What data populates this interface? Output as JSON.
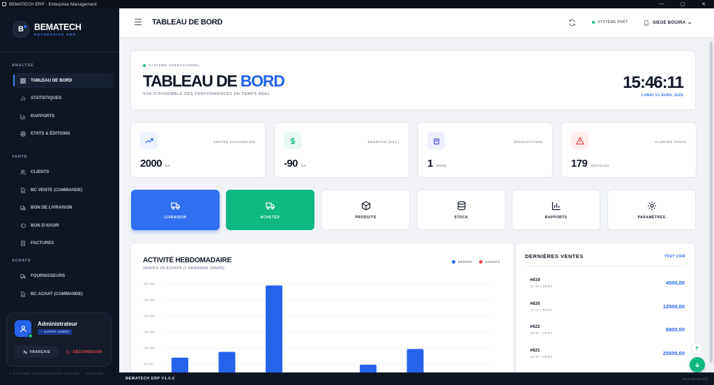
{
  "window": {
    "title": "BEMATECH ERP - Enterprise Management",
    "controls": {
      "minimize": "—",
      "maximize": "▢",
      "close": "✕"
    }
  },
  "brand": {
    "logo": "B",
    "name": "BEMATECH",
    "subtitle": "ENTERPRISE ERP"
  },
  "sidebar": {
    "sections": [
      {
        "label": "ANALYSE",
        "items": [
          {
            "label": "TABLEAU DE BORD",
            "icon": "dashboard-icon",
            "active": true
          },
          {
            "label": "STATISTIQUES",
            "icon": "stats-icon"
          },
          {
            "label": "RAPPORTS",
            "icon": "bar-chart-icon"
          },
          {
            "label": "ETATS & ÉDITIONS",
            "icon": "printer-icon"
          }
        ]
      },
      {
        "label": "VENTE",
        "items": [
          {
            "label": "CLIENTS",
            "icon": "users-icon"
          },
          {
            "label": "BC VENTE (COMMANDE)",
            "icon": "document-icon"
          },
          {
            "label": "BON DE LIVRAISON",
            "icon": "truck-icon"
          },
          {
            "label": "BON D'AVOIR",
            "icon": "undo-icon"
          },
          {
            "label": "FACTURES",
            "icon": "invoice-icon"
          }
        ]
      },
      {
        "label": "ACHATS",
        "items": [
          {
            "label": "FOURNISSEURS",
            "icon": "truck-icon"
          },
          {
            "label": "BC ACHAT (COMMANDE)",
            "icon": "document-icon"
          }
        ]
      }
    ]
  },
  "user": {
    "name": "Administrateur",
    "role": "⚡ SUPER ADMIN",
    "lang_button": "FRANÇAIS",
    "logout_button": "DÉCONNEXION"
  },
  "sidebar_footer": {
    "left": "• SYSTEM INTELLIGENCE ACTIVE",
    "right": "SECURE"
  },
  "topbar": {
    "title": "TABLEAU DE BORD",
    "status": "SYSTÈME PRÊT",
    "site": "SIEGE BOUIRA"
  },
  "hero": {
    "status": "SYSTÈME OPÉRATIONNEL",
    "title_part1": "TABLEAU DE ",
    "title_part2": "BORD",
    "subtitle": "VUE D'ENSEMBLE DES PERFORMANCES EN TEMPS RÉEL",
    "time": "15:46:11",
    "date": "LUNDI 13 AVRIL 2026"
  },
  "stats": [
    {
      "label": "VENTES AUJOURD'HUI",
      "value": "2000",
      "unit": "DA",
      "icon": "trend-up-icon",
      "color": "#2563eb",
      "bg": "#eef3ff"
    },
    {
      "label": "BÉNÉFICE (EST.)",
      "value": "-90",
      "unit": "DA",
      "icon": "dollar-icon",
      "color": "#10b981",
      "bg": "#e8f8f1"
    },
    {
      "label": "TRANSACTIONS",
      "value": "1",
      "unit": "BONS",
      "icon": "shopping-bag-icon",
      "color": "#4f46e5",
      "bg": "#eef0ff"
    },
    {
      "label": "ALERTES STOCK",
      "value": "179",
      "unit": "ARTICLES",
      "icon": "warning-icon",
      "color": "#ef4444",
      "bg": "#fdeeee"
    }
  ],
  "quick_actions": [
    {
      "label": "LIVRAISON",
      "icon": "truck-icon",
      "style": "blue"
    },
    {
      "label": "ACHETER",
      "icon": "truck-icon",
      "style": "green"
    },
    {
      "label": "PRODUITS",
      "icon": "box-icon",
      "style": "white"
    },
    {
      "label": "STOCK",
      "icon": "database-icon",
      "style": "white"
    },
    {
      "label": "RAPPORTS",
      "icon": "bar-chart-icon",
      "style": "white"
    },
    {
      "label": "PARAMÈTRES",
      "icon": "gear-icon",
      "style": "white"
    }
  ],
  "chart": {
    "title": "ACTIVITÉ HEBDOMADAIRE",
    "subtitle": "VENTES VS ACHATS (7 DERNIERS JOURS)"
  },
  "chart_data": {
    "type": "bar",
    "title": "ACTIVITÉ HEBDOMADAIRE",
    "subtitle": "VENTES VS ACHATS (7 DERNIERS JOURS)",
    "categories": [
      "",
      "",
      "",
      "",
      "",
      "",
      ""
    ],
    "series": [
      {
        "name": "VENTES",
        "color": "#2563eb",
        "values": [
          70000,
          88000,
          295000,
          0,
          48000,
          97000,
          0
        ]
      },
      {
        "name": "ACHATS",
        "color": "#ef4444",
        "values": [
          0,
          0,
          0,
          0,
          0,
          0,
          0
        ]
      }
    ],
    "yticks": [
      {
        "value": 300000,
        "label": "300 000"
      },
      {
        "value": 250000,
        "label": "250 000"
      },
      {
        "value": 200000,
        "label": "200 000"
      },
      {
        "value": 150000,
        "label": "150 000"
      },
      {
        "value": 100000,
        "label": "100 000"
      },
      {
        "value": 50000,
        "label": "50 000"
      }
    ],
    "ylim": [
      0,
      300000
    ],
    "grid": true,
    "legend": "top-right"
  },
  "sales": {
    "title": "DERNIÈRES VENTES",
    "view_all": "TOUT VOIR",
    "items": [
      {
        "id": "#619",
        "meta": "10:30 • DEBT",
        "amount": "4500,00"
      },
      {
        "id": "#620",
        "meta": "10:47 • DEBT",
        "amount": "12500,00"
      },
      {
        "id": "#622",
        "meta": "10:30 • DEBT",
        "amount": "6800,00"
      },
      {
        "id": "#621",
        "meta": "10:30 • DEBT",
        "amount": "25500,00"
      }
    ]
  },
  "footer": {
    "left": "BEMATECH ERP V1.0.0",
    "right": "V2.0.26-ELITE"
  }
}
